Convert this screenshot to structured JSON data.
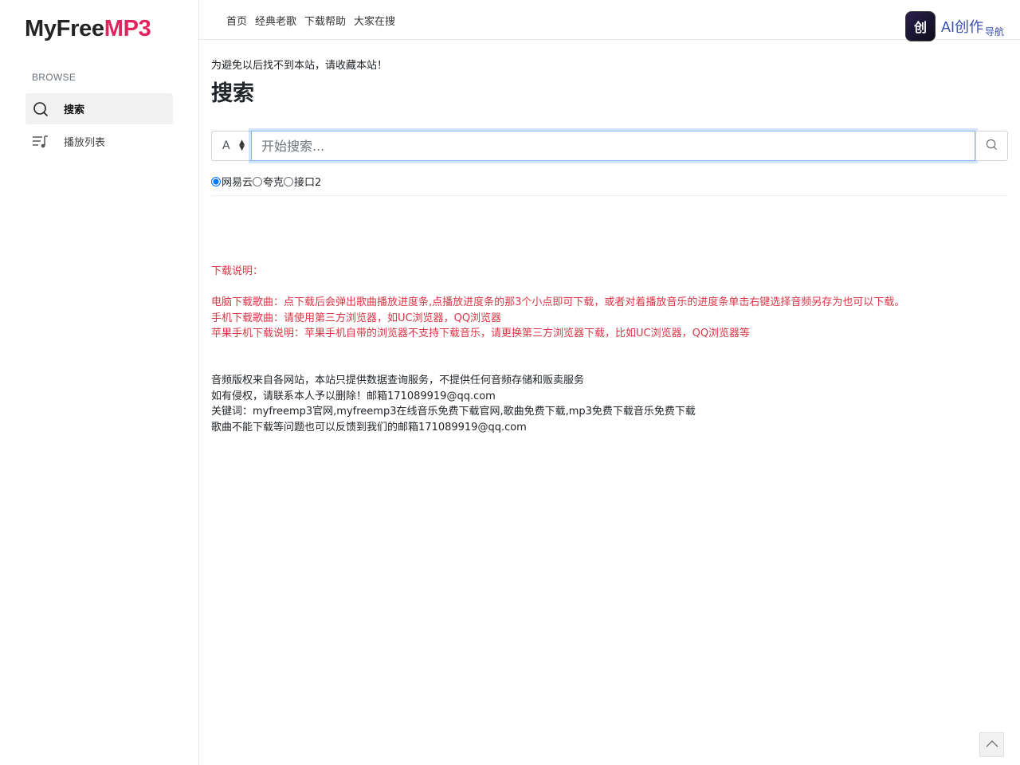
{
  "logo": {
    "part1": "MyFree",
    "part2": "MP3"
  },
  "sidebar": {
    "section_label": "BROWSE",
    "items": [
      {
        "label": "搜索",
        "icon": "search-icon",
        "active": true
      },
      {
        "label": "播放列表",
        "icon": "playlist-icon",
        "active": false
      }
    ]
  },
  "topnav": {
    "items": [
      "首页",
      "经典老歌",
      "下载帮助",
      "大家在搜"
    ],
    "badge_app_glyph": "创",
    "badge_text": "AI创作",
    "badge_sub": "导航"
  },
  "main": {
    "notice": "为避免以后找不到本站，请收藏本站！",
    "title": "搜索",
    "select_value": "A",
    "search_placeholder": "开始搜索...",
    "radios": [
      {
        "label": "网易云",
        "checked": true
      },
      {
        "label": "夸克",
        "checked": false
      },
      {
        "label": "接口2",
        "checked": false
      }
    ]
  },
  "download_notes": {
    "heading": "下载说明：",
    "pc": "电脑下载歌曲：点下载后会弹出歌曲播放进度条,点播放进度条的那3个小点即可下载，或者对着播放音乐的进度条单击右键选择音频另存为也可以下载。",
    "mobile": "手机下载歌曲：请使用第三方浏览器，如UC浏览器，QQ浏览器",
    "apple": "苹果手机下载说明：苹果手机自带的浏览器不支持下载音乐，请更换第三方浏览器下载，比如UC浏览器，QQ浏览器等"
  },
  "footer_notes": {
    "line1": "音频版权来自各网站，本站只提供数据查询服务，不提供任何音频存储和贩卖服务",
    "line2": "如有侵权，请联系本人予以删除！邮箱171089919@qq.com",
    "line3": "关键词：myfreemp3官网,myfreemp3在线音乐免费下载官网,歌曲免费下载,mp3免费下载音乐免费下载",
    "line4": "歌曲不能下载等问题也可以反馈到我们的邮箱171089919@qq.com"
  },
  "colors": {
    "brand_accent": "#e0245e",
    "note_red": "#dc3545",
    "focus_blue": "#86b7fe"
  }
}
